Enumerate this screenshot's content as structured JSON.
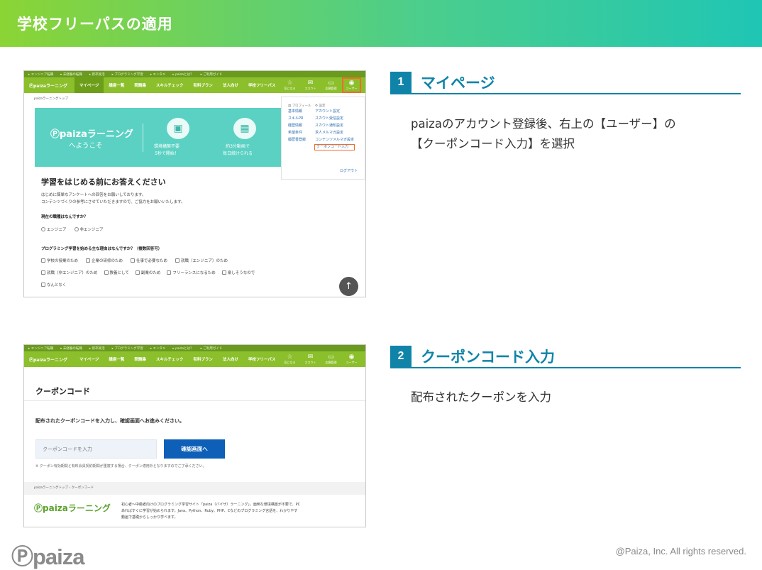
{
  "header": {
    "title": "学校フリーパスの適用"
  },
  "site": {
    "top_links": [
      "▸ エンジニア転職",
      "▸ 未経験の転職",
      "▸ 新卒就活",
      "▸ プログラミング学習",
      "▸ エンタメ",
      "▸ paizaとは？",
      "▸ ご利用ガイド"
    ],
    "logo": "Ⓟpaizaラーニング",
    "nav": [
      "マイページ",
      "講座一覧",
      "問題集",
      "スキルチェック",
      "有料プラン",
      "法人向け",
      "学校フリーパス"
    ],
    "icons": [
      {
        "icon": "star-icon",
        "glyph": "☆",
        "label": "気になる"
      },
      {
        "icon": "mail-icon",
        "glyph": "✉",
        "label": "スカウト"
      },
      {
        "icon": "calendar-icon",
        "glyph": "▭",
        "label": "応募管理"
      },
      {
        "icon": "user-icon",
        "glyph": "◉",
        "label": "ユーザー"
      }
    ]
  },
  "shot1": {
    "breadcrumb": "paizaラーニングトップ",
    "banner": {
      "logo": "Ⓟpaizaラーニング",
      "welcome": "へようこそ",
      "feature1": "環境構築不要\n5秒で開始！",
      "feature2": "約3分動画で\n毎日続けられる"
    },
    "dropdown": {
      "head_profile": "▤ プロフィール",
      "head_settings": "⚙ 設定",
      "col1": [
        "基本情報",
        "スキルPR",
        "経歴情報",
        "希望条件",
        "履歴書登録"
      ],
      "col2": [
        "アカウント設定",
        "スカウト受信設定",
        "スカウト通知設定",
        "求人メルマガ設定",
        "コンテンツメルマガ設定"
      ],
      "highlight": "クーポンコード入力",
      "logout": "ログアウト"
    },
    "survey": {
      "title": "学習をはじめる前にお答えください",
      "intro1": "はじめに簡単なアンケートへの回答をお願いしております。",
      "intro2": "コンテンツづくりの参考にさせていただきますので、ご協力をお願いいたします。",
      "q1": "現在の職種はなんですか？",
      "q1_options": [
        "エンジニア",
        "非エンジニア"
      ],
      "q2": "プログラミング学習を始める主な理由はなんですか？（複数回答可）",
      "q2_row1": [
        "学校の授業のため",
        "企業の研修のため",
        "仕事で必要なため",
        "就職（エンジニア）のため"
      ],
      "q2_row2": [
        "就職（非エンジニア）のため",
        "教養として",
        "副業のため",
        "フリーランスになるため",
        "楽しそうなので"
      ],
      "q2_row3": [
        "なんとなく"
      ]
    },
    "scroll_up": "↑"
  },
  "shot2": {
    "title": "クーポンコード",
    "instruction": "配布されたクーポンコードを入力し、確認画面へお進みください。",
    "input_placeholder": "クーポンコードを入力",
    "button": "確認画面へ",
    "note": "※ クーポン有効期間と有料会員契約期間が重複する場合、クーポン適用外となりますのでご了承ください。",
    "breadcrumb": "paizaラーニングトップ  ›  クーポンコード",
    "footer_logo": "Ⓟpaizaラーニング",
    "footer_text": [
      "初心者〜中級者向けのプログラミング学習サイト「paiza（パイザ）ラーニング」。面倒な環境構築が不要で、PC",
      "あればすぐに学習が始められます。Java、Python、Ruby、PHP、Cなどのプログラミング言語を、わかりやす",
      "動画で基礎からしっかり学べます。"
    ]
  },
  "steps": [
    {
      "num": "1",
      "title": "マイページ",
      "desc": "paizaのアカウント登録後、右上の【ユーザー】の\n【クーポンコード入力】を選択"
    },
    {
      "num": "2",
      "title": "クーポンコード入力",
      "desc": "配布されたクーポンを入力"
    }
  ],
  "footer": {
    "brand": "Ⓟpaiza",
    "copyright": "@Paiza, Inc. All rights reserved."
  },
  "colors": {
    "accent": "#0f84a8",
    "nav_green": "#8bbf2b",
    "teal": "#5ad1c3",
    "highlight": "#ef6c2a",
    "button_blue": "#0d5fb8"
  }
}
